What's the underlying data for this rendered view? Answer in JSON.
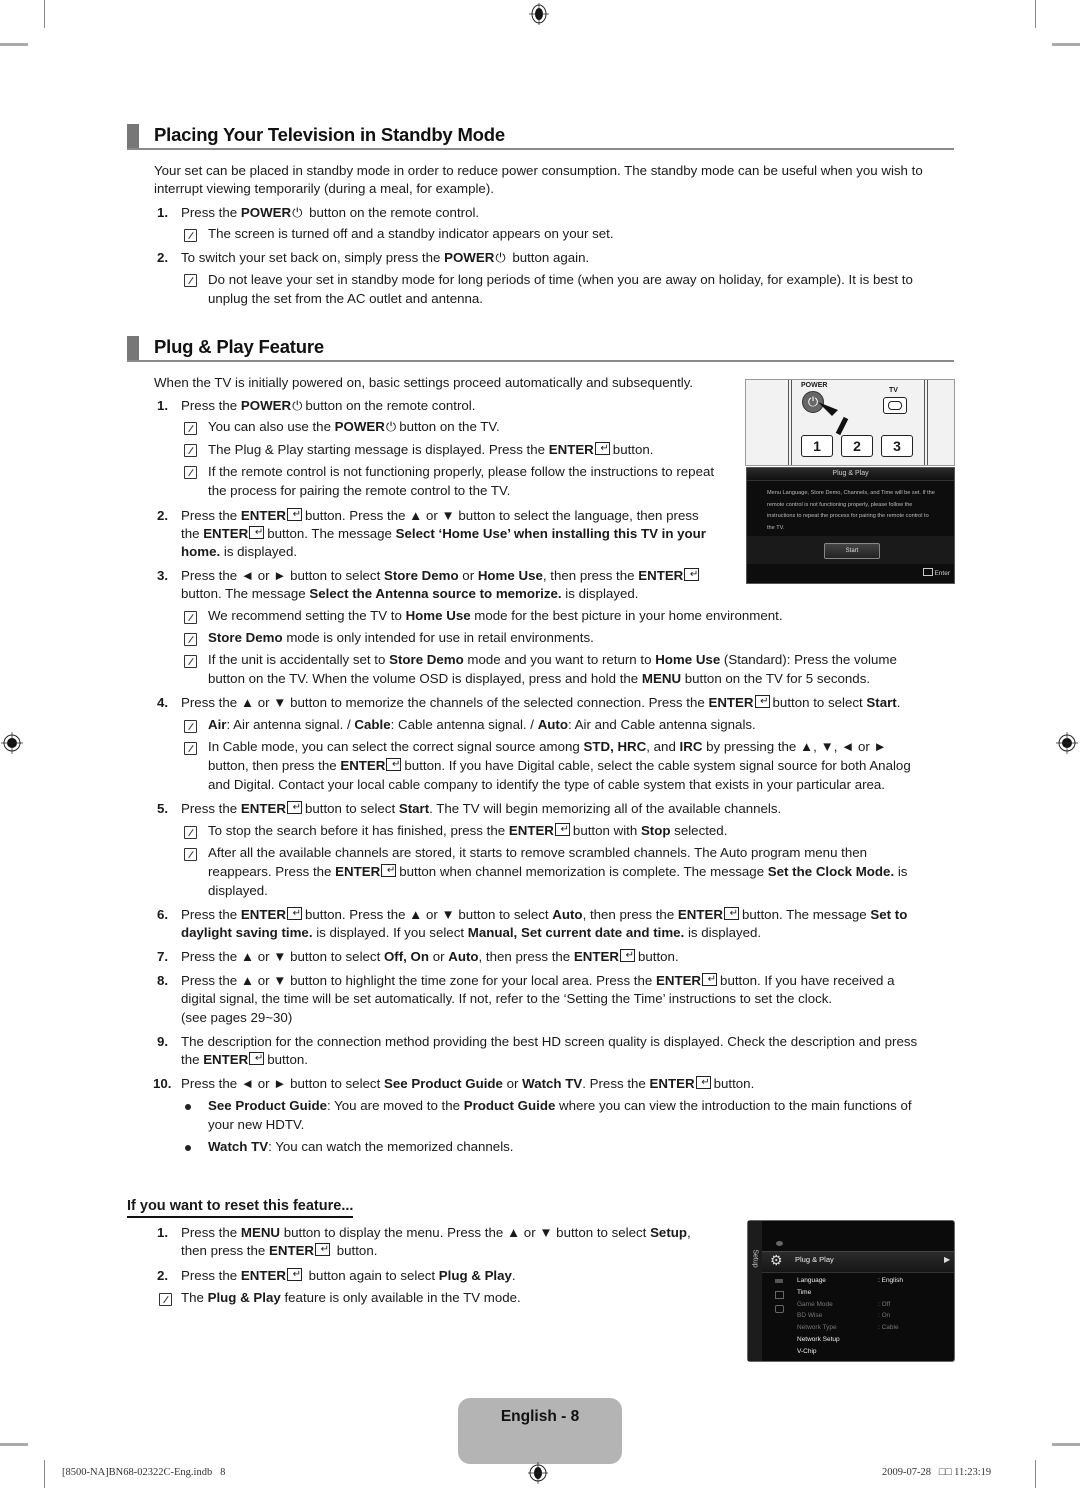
{
  "section1": {
    "title": "Placing Your Television in Standby Mode",
    "intro_line1": "Your set can be placed in standby mode in order to reduce power consumption. The standby mode can be useful when you wish to",
    "intro_line2": "interrupt viewing temporarily (during a meal, for example).",
    "steps": [
      {
        "num": "1.",
        "pre": "Press the ",
        "bold": "POWER",
        "post": " button on the remote control."
      },
      {
        "num": "2.",
        "pre": "To switch your set back on, simply press the ",
        "bold": "POWER",
        "post": " button again."
      }
    ],
    "notes": [
      "The screen is turned off and a standby indicator appears on your set.",
      "Do not leave your set in standby mode for long periods of time (when you are away on holiday, for example). It is best to",
      "unplug the set from the AC outlet and antenna."
    ]
  },
  "section2": {
    "title": "Plug & Play Feature",
    "intro": "When the TV is initially powered on, basic settings proceed automatically and subsequently."
  },
  "remote_image": {
    "power_label": "POWER",
    "tv_label": "TV",
    "keys": [
      "1",
      "2",
      "3"
    ]
  },
  "osd": {
    "title": "Plug & Play",
    "message": "Menu Language, Store Demo, Channels, and Time will be set. If the remote control is not functioning properly, please follow the instructions to repeat the process for pairing the remote control to the TV.",
    "start_button": "Start",
    "enter_hint": "Enter"
  },
  "reset": {
    "heading": "If you want to reset this feature...",
    "note": "feature is only available in the TV mode."
  },
  "setup_menu": {
    "side_label": "Setup",
    "selected_item": "Plug & Play",
    "items": [
      {
        "label": "Language",
        "value": ": English",
        "enabled": true
      },
      {
        "label": "Time",
        "value": "",
        "enabled": true
      },
      {
        "label": "Game Mode",
        "value": ": Off",
        "enabled": false
      },
      {
        "label": "BD Wise",
        "value": ": On",
        "enabled": false
      },
      {
        "label": "Network Type",
        "value": ": Cable",
        "enabled": false
      },
      {
        "label": "Network Setup",
        "value": "",
        "enabled": true
      },
      {
        "label": "V-Chip",
        "value": "",
        "enabled": true
      }
    ]
  },
  "footer": {
    "page_label": "English - 8",
    "file_info": "[8500-NA]BN68-02322C-Eng.indb   8",
    "timestamp": "2009-07-28   □□ 11:23:19"
  }
}
